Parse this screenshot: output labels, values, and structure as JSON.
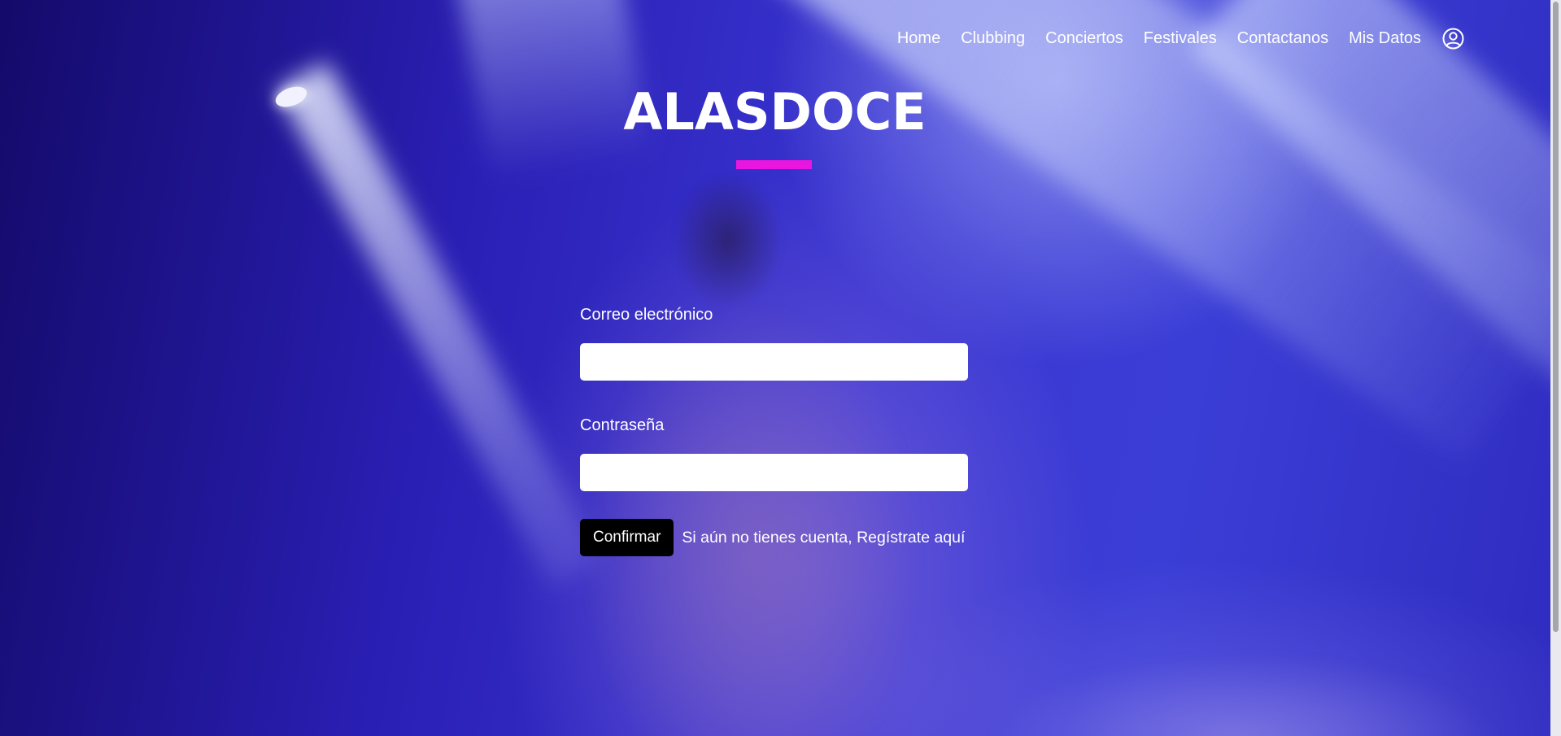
{
  "nav": {
    "items": [
      {
        "label": "Home"
      },
      {
        "label": "Clubbing"
      },
      {
        "label": "Conciertos"
      },
      {
        "label": "Festivales"
      },
      {
        "label": "Contactanos"
      },
      {
        "label": "Mis Datos"
      }
    ],
    "account_icon": "user-circle-icon"
  },
  "hero": {
    "title": "ALASDOCE",
    "accent_color": "#ea16e0"
  },
  "login": {
    "email_label": "Correo electrónico",
    "email_value": "",
    "password_label": "Contraseña",
    "password_value": "",
    "confirm_label": "Confirmar",
    "register_prompt": "Si aún no tienes cuenta,",
    "register_link": "Regístrate aquí"
  },
  "colors": {
    "background": "#2a22b8",
    "button": "#000000",
    "text": "#ffffff"
  }
}
